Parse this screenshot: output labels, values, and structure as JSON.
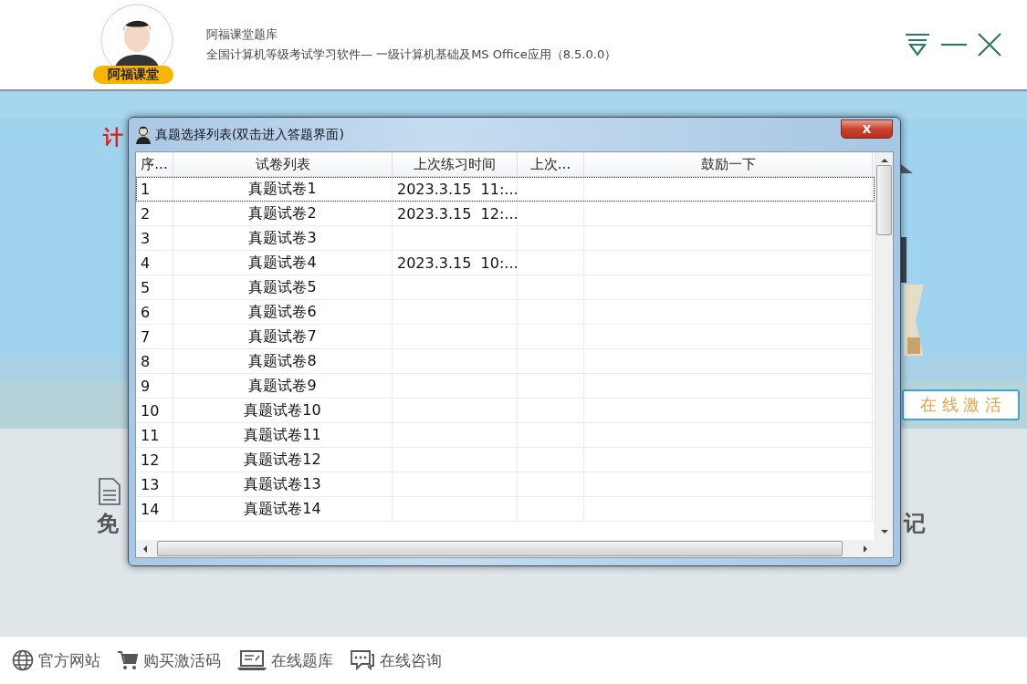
{
  "header": {
    "badge": "阿福课堂",
    "app_name": "阿福课堂题库",
    "subtitle": "全国计算机等级考试学习软件— 一级计算机基础及MS Office应用（8.5.0.0）"
  },
  "banner": {
    "tag": "计"
  },
  "activate_button": "在 线 激 活",
  "section": {
    "left_text": "免",
    "right_text": "记"
  },
  "footer": [
    {
      "kind": "globe",
      "label": "官方网站"
    },
    {
      "kind": "cart",
      "label": "购买激活码"
    },
    {
      "kind": "laptop",
      "label": "在线题库"
    },
    {
      "kind": "chat",
      "label": "在线咨询"
    }
  ],
  "dialog": {
    "title": "真题选择列表(双击进入答题界面)",
    "close": "X",
    "columns": [
      "序...",
      "试卷列表",
      "上次练习时间",
      "上次...",
      "鼓励一下"
    ],
    "rows": [
      {
        "cells": [
          "1",
          "真题试卷1",
          "2023.3.15  11:...",
          "",
          ""
        ],
        "selected": true
      },
      {
        "cells": [
          "2",
          "真题试卷2",
          "2023.3.15  12:...",
          "",
          ""
        ],
        "selected": false
      },
      {
        "cells": [
          "3",
          "真题试卷3",
          "",
          "",
          ""
        ],
        "selected": false
      },
      {
        "cells": [
          "4",
          "真题试卷4",
          "2023.3.15  10:...",
          "",
          ""
        ],
        "selected": false
      },
      {
        "cells": [
          "5",
          "真题试卷5",
          "",
          "",
          ""
        ],
        "selected": false
      },
      {
        "cells": [
          "6",
          "真题试卷6",
          "",
          "",
          ""
        ],
        "selected": false
      },
      {
        "cells": [
          "7",
          "真题试卷7",
          "",
          "",
          ""
        ],
        "selected": false
      },
      {
        "cells": [
          "8",
          "真题试卷8",
          "",
          "",
          ""
        ],
        "selected": false
      },
      {
        "cells": [
          "9",
          "真题试卷9",
          "",
          "",
          ""
        ],
        "selected": false
      },
      {
        "cells": [
          "10",
          "真题试卷10",
          "",
          "",
          ""
        ],
        "selected": false
      },
      {
        "cells": [
          "11",
          "真题试卷11",
          "",
          "",
          ""
        ],
        "selected": false
      },
      {
        "cells": [
          "12",
          "真题试卷12",
          "",
          "",
          ""
        ],
        "selected": false
      },
      {
        "cells": [
          "13",
          "真题试卷13",
          "",
          "",
          ""
        ],
        "selected": false
      },
      {
        "cells": [
          "14",
          "真题试卷14",
          "",
          "",
          ""
        ],
        "selected": false
      }
    ]
  }
}
